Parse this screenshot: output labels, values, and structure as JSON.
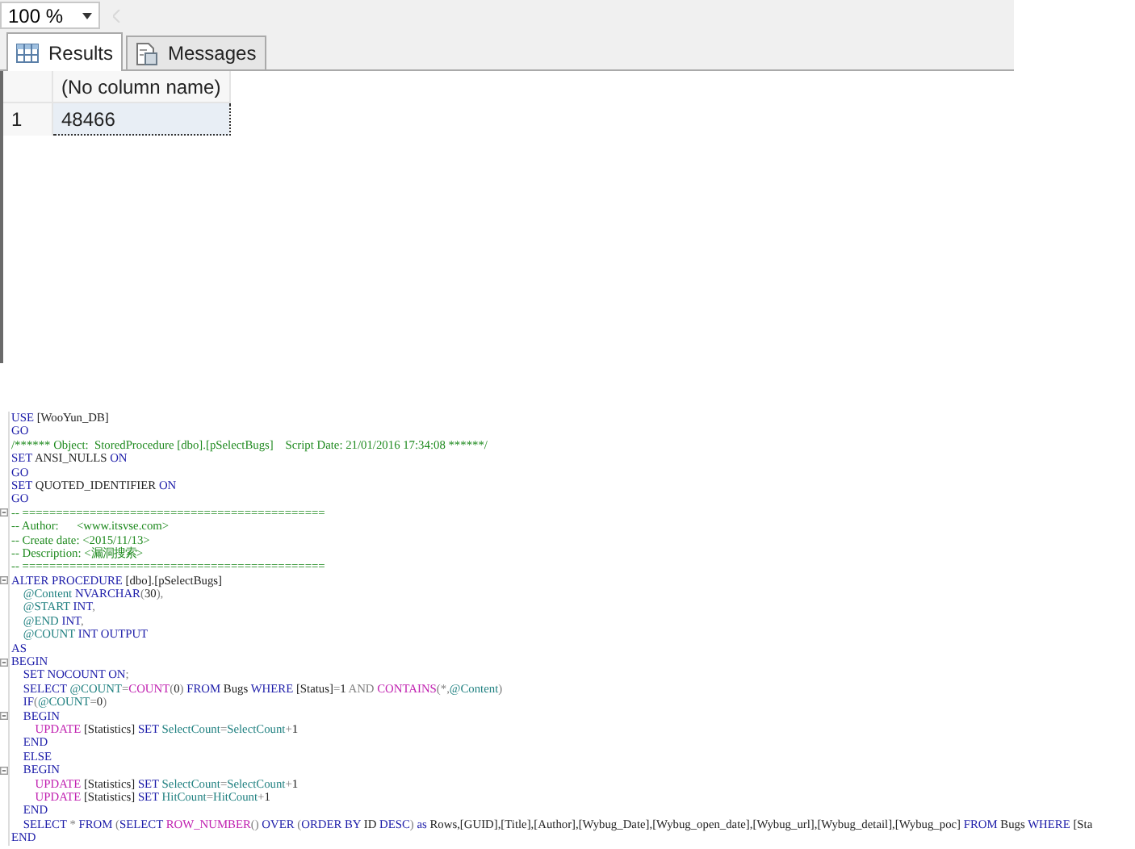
{
  "zoom": {
    "value": "100 %"
  },
  "tabs": [
    {
      "label": "Results",
      "selected": true
    },
    {
      "label": "Messages",
      "selected": false
    }
  ],
  "grid": {
    "columns": [
      "(No column name)"
    ],
    "rows": [
      {
        "row_number": "1",
        "cells": [
          "48466"
        ],
        "selected": true
      }
    ]
  },
  "editor": {
    "lines": [
      {
        "fold": false,
        "segments": [
          {
            "kind": "keyword",
            "text": "USE"
          },
          {
            "kind": "plain",
            "text": " [WooYun_DB]"
          }
        ]
      },
      {
        "fold": false,
        "segments": [
          {
            "kind": "keyword",
            "text": "GO"
          }
        ]
      },
      {
        "fold": false,
        "segments": [
          {
            "kind": "comment",
            "text": "/****** Object:  StoredProcedure [dbo].[pSelectBugs]    Script Date: 21/01/2016 17:34:08 ******/"
          }
        ]
      },
      {
        "fold": false,
        "segments": [
          {
            "kind": "keyword",
            "text": "SET"
          },
          {
            "kind": "plain",
            "text": " ANSI_NULLS "
          },
          {
            "kind": "keyword",
            "text": "ON"
          }
        ]
      },
      {
        "fold": false,
        "segments": [
          {
            "kind": "keyword",
            "text": "GO"
          }
        ]
      },
      {
        "fold": false,
        "segments": [
          {
            "kind": "keyword",
            "text": "SET"
          },
          {
            "kind": "plain",
            "text": " QUOTED_IDENTIFIER "
          },
          {
            "kind": "keyword",
            "text": "ON"
          }
        ]
      },
      {
        "fold": false,
        "segments": [
          {
            "kind": "keyword",
            "text": "GO"
          }
        ]
      },
      {
        "fold": true,
        "segments": [
          {
            "kind": "comment",
            "text": "-- ============================================="
          }
        ]
      },
      {
        "fold": false,
        "segments": [
          {
            "kind": "comment",
            "text": "-- Author:      <www.itsvse.com>"
          }
        ]
      },
      {
        "fold": false,
        "segments": [
          {
            "kind": "comment",
            "text": "-- Create date: <2015/11/13>"
          }
        ]
      },
      {
        "fold": false,
        "segments": [
          {
            "kind": "comment",
            "text": "-- Description: <漏洞搜索>"
          }
        ]
      },
      {
        "fold": false,
        "segments": [
          {
            "kind": "comment",
            "text": "-- ============================================="
          }
        ]
      },
      {
        "fold": true,
        "segments": [
          {
            "kind": "keyword",
            "text": "ALTER PROCEDURE"
          },
          {
            "kind": "plain",
            "text": " [dbo].[pSelectBugs]"
          }
        ]
      },
      {
        "fold": false,
        "segments": [
          {
            "kind": "variable",
            "text": "    @Content"
          },
          {
            "kind": "keyword",
            "text": " NVARCHAR"
          },
          {
            "kind": "operator",
            "text": "("
          },
          {
            "kind": "plain",
            "text": "30"
          },
          {
            "kind": "operator",
            "text": "),"
          }
        ]
      },
      {
        "fold": false,
        "segments": [
          {
            "kind": "variable",
            "text": "    @START"
          },
          {
            "kind": "keyword",
            "text": " INT"
          },
          {
            "kind": "operator",
            "text": ","
          }
        ]
      },
      {
        "fold": false,
        "segments": [
          {
            "kind": "variable",
            "text": "    @END"
          },
          {
            "kind": "keyword",
            "text": " INT"
          },
          {
            "kind": "operator",
            "text": ","
          }
        ]
      },
      {
        "fold": false,
        "segments": [
          {
            "kind": "variable",
            "text": "    @COUNT"
          },
          {
            "kind": "keyword",
            "text": " INT OUTPUT"
          }
        ]
      },
      {
        "fold": false,
        "segments": [
          {
            "kind": "keyword",
            "text": "AS"
          }
        ]
      },
      {
        "fold": true,
        "segments": [
          {
            "kind": "keyword",
            "text": "BEGIN"
          }
        ]
      },
      {
        "fold": false,
        "segments": [
          {
            "kind": "keyword",
            "text": "    SET NOCOUNT ON"
          },
          {
            "kind": "operator",
            "text": ";"
          }
        ]
      },
      {
        "fold": false,
        "segments": [
          {
            "kind": "keyword",
            "text": "    SELECT "
          },
          {
            "kind": "variable",
            "text": "@COUNT"
          },
          {
            "kind": "operator",
            "text": "="
          },
          {
            "kind": "function",
            "text": "COUNT"
          },
          {
            "kind": "operator",
            "text": "("
          },
          {
            "kind": "plain",
            "text": "0"
          },
          {
            "kind": "operator",
            "text": ")"
          },
          {
            "kind": "keyword",
            "text": " FROM"
          },
          {
            "kind": "plain",
            "text": " Bugs "
          },
          {
            "kind": "keyword",
            "text": "WHERE"
          },
          {
            "kind": "plain",
            "text": " [Status]"
          },
          {
            "kind": "operator",
            "text": "="
          },
          {
            "kind": "plain",
            "text": "1 "
          },
          {
            "kind": "operator",
            "text": "AND "
          },
          {
            "kind": "function",
            "text": "CONTAINS"
          },
          {
            "kind": "operator",
            "text": "(*,"
          },
          {
            "kind": "variable",
            "text": "@Content"
          },
          {
            "kind": "operator",
            "text": ")"
          }
        ]
      },
      {
        "fold": false,
        "segments": [
          {
            "kind": "keyword",
            "text": "    IF"
          },
          {
            "kind": "operator",
            "text": "("
          },
          {
            "kind": "variable",
            "text": "@COUNT"
          },
          {
            "kind": "operator",
            "text": "="
          },
          {
            "kind": "plain",
            "text": "0"
          },
          {
            "kind": "operator",
            "text": ")"
          }
        ]
      },
      {
        "fold": true,
        "segments": [
          {
            "kind": "keyword",
            "text": "    BEGIN"
          }
        ]
      },
      {
        "fold": false,
        "segments": [
          {
            "kind": "function",
            "text": "        UPDATE"
          },
          {
            "kind": "plain",
            "text": " [Statistics] "
          },
          {
            "kind": "keyword",
            "text": "SET"
          },
          {
            "kind": "variable",
            "text": " SelectCount"
          },
          {
            "kind": "operator",
            "text": "="
          },
          {
            "kind": "variable",
            "text": "SelectCount"
          },
          {
            "kind": "operator",
            "text": "+"
          },
          {
            "kind": "plain",
            "text": "1"
          }
        ]
      },
      {
        "fold": false,
        "segments": [
          {
            "kind": "keyword",
            "text": "    END"
          }
        ]
      },
      {
        "fold": false,
        "segments": [
          {
            "kind": "keyword",
            "text": "    ELSE"
          }
        ]
      },
      {
        "fold": true,
        "segments": [
          {
            "kind": "keyword",
            "text": "    BEGIN"
          }
        ]
      },
      {
        "fold": false,
        "segments": [
          {
            "kind": "function",
            "text": "        UPDATE"
          },
          {
            "kind": "plain",
            "text": " [Statistics] "
          },
          {
            "kind": "keyword",
            "text": "SET"
          },
          {
            "kind": "variable",
            "text": " SelectCount"
          },
          {
            "kind": "operator",
            "text": "="
          },
          {
            "kind": "variable",
            "text": "SelectCount"
          },
          {
            "kind": "operator",
            "text": "+"
          },
          {
            "kind": "plain",
            "text": "1"
          }
        ]
      },
      {
        "fold": false,
        "segments": [
          {
            "kind": "function",
            "text": "        UPDATE"
          },
          {
            "kind": "plain",
            "text": " [Statistics] "
          },
          {
            "kind": "keyword",
            "text": "SET"
          },
          {
            "kind": "variable",
            "text": " HitCount"
          },
          {
            "kind": "operator",
            "text": "="
          },
          {
            "kind": "variable",
            "text": "HitCount"
          },
          {
            "kind": "operator",
            "text": "+"
          },
          {
            "kind": "plain",
            "text": "1"
          }
        ]
      },
      {
        "fold": false,
        "segments": [
          {
            "kind": "keyword",
            "text": "    END"
          }
        ]
      },
      {
        "fold": false,
        "segments": [
          {
            "kind": "keyword",
            "text": "    SELECT "
          },
          {
            "kind": "operator",
            "text": "* "
          },
          {
            "kind": "keyword",
            "text": "FROM "
          },
          {
            "kind": "operator",
            "text": "("
          },
          {
            "kind": "keyword",
            "text": "SELECT "
          },
          {
            "kind": "function",
            "text": "ROW_NUMBER"
          },
          {
            "kind": "operator",
            "text": "() "
          },
          {
            "kind": "keyword",
            "text": "OVER "
          },
          {
            "kind": "operator",
            "text": "("
          },
          {
            "kind": "keyword",
            "text": "ORDER BY "
          },
          {
            "kind": "plain",
            "text": "ID "
          },
          {
            "kind": "keyword",
            "text": "DESC"
          },
          {
            "kind": "operator",
            "text": ") "
          },
          {
            "kind": "keyword",
            "text": "as "
          },
          {
            "kind": "plain",
            "text": "Rows,[GUID],[Title],[Author],[Wybug_Date],[Wybug_open_date],[Wybug_url],[Wybug_detail],[Wybug_poc] "
          },
          {
            "kind": "keyword",
            "text": "FROM "
          },
          {
            "kind": "plain",
            "text": "Bugs "
          },
          {
            "kind": "keyword",
            "text": "WHERE "
          },
          {
            "kind": "plain",
            "text": "[Sta"
          }
        ]
      },
      {
        "fold": false,
        "segments": [
          {
            "kind": "keyword",
            "text": "END"
          }
        ]
      }
    ]
  }
}
